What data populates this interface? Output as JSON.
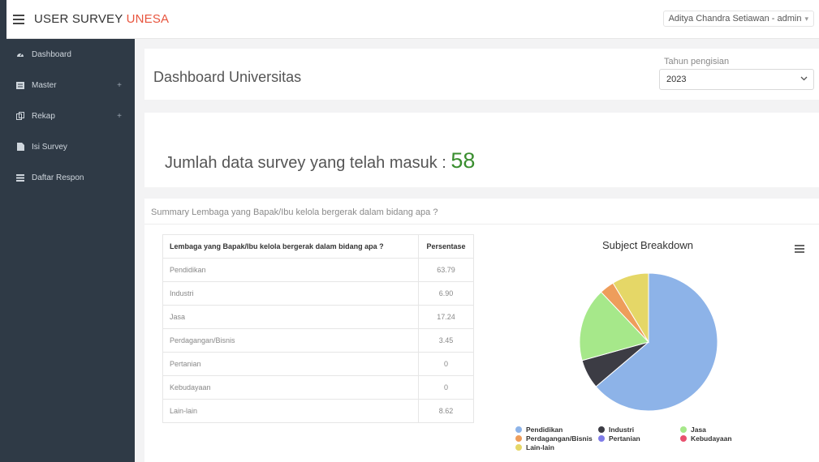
{
  "app": {
    "brand_main": "USER SURVEY ",
    "brand_accent": "UNESA",
    "user": "Aditya Chandra Setiawan - admin"
  },
  "sidebar": {
    "items": [
      {
        "label": "Dashboard",
        "icon": "dashboard-icon",
        "expandable": false
      },
      {
        "label": "Master",
        "icon": "master-icon",
        "expandable": true
      },
      {
        "label": "Rekap",
        "icon": "rekap-icon",
        "expandable": true
      },
      {
        "label": "Isi Survey",
        "icon": "file-icon",
        "expandable": false
      },
      {
        "label": "Daftar Respon",
        "icon": "list-icon",
        "expandable": false
      }
    ],
    "plus_glyph": "+"
  },
  "header": {
    "title": "Dashboard Universitas",
    "year_label": "Tahun pengisian",
    "year_value": "2023"
  },
  "stats": {
    "label": "Jumlah data survey yang telah masuk : ",
    "count": "58"
  },
  "summary": {
    "title": "Summary Lembaga yang Bapak/Ibu kelola bergerak dalam bidang apa ?",
    "columns": [
      "Lembaga yang Bapak/Ibu kelola bergerak dalam bidang apa ?",
      "Persentase"
    ],
    "rows": [
      [
        "Pendidikan",
        "63.79"
      ],
      [
        "Industri",
        "6.90"
      ],
      [
        "Jasa",
        "17.24"
      ],
      [
        "Perdagangan/Bisnis",
        "3.45"
      ],
      [
        "Pertanian",
        "0"
      ],
      [
        "Kebudayaan",
        "0"
      ],
      [
        "Lain-lain",
        "8.62"
      ]
    ]
  },
  "chart_data": {
    "type": "pie",
    "title": "Subject Breakdown",
    "categories": [
      "Pendidikan",
      "Industri",
      "Jasa",
      "Perdagangan/Bisnis",
      "Pertanian",
      "Kebudayaan",
      "Lain-lain"
    ],
    "values": [
      63.79,
      6.9,
      17.24,
      3.45,
      0,
      0,
      8.62
    ],
    "colors": [
      "#8db3e8",
      "#3c3c44",
      "#a6e88a",
      "#ee9d5b",
      "#7f7ce8",
      "#e8506e",
      "#e5d767"
    ],
    "legend_position": "bottom"
  }
}
